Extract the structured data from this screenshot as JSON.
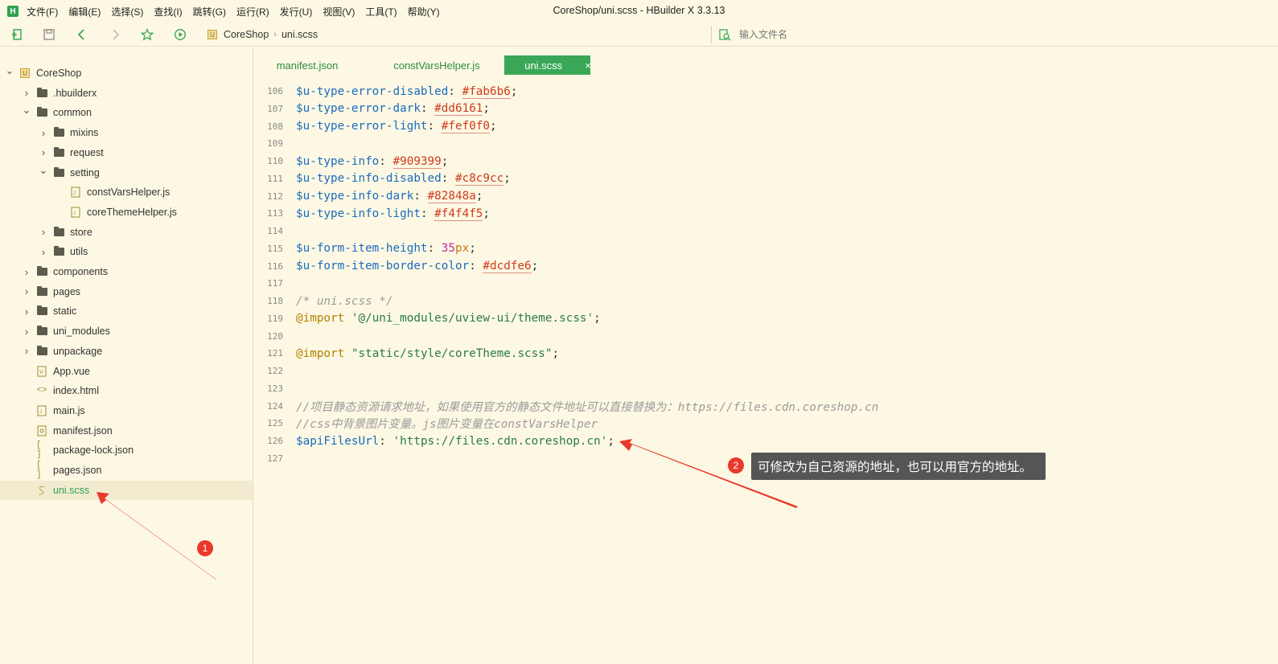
{
  "app": {
    "logo_letter": "H",
    "window_title": "CoreShop/uni.scss - HBuilder X 3.3.13",
    "accent_color": "#3aa757"
  },
  "menu": [
    "文件(F)",
    "编辑(E)",
    "选择(S)",
    "查找(I)",
    "跳转(G)",
    "运行(R)",
    "发行(U)",
    "视图(V)",
    "工具(T)",
    "帮助(Y)"
  ],
  "toolbar": {
    "icons": [
      "new-file-icon",
      "save-icon",
      "back-icon",
      "forward-icon",
      "star-icon",
      "run-icon"
    ],
    "breadcrumb": {
      "project": "CoreShop",
      "file": "uni.scss",
      "badge": "U"
    },
    "search_placeholder": "输入文件名"
  },
  "sidebar": {
    "items": [
      {
        "label": "CoreShop",
        "type": "project",
        "expanded": true,
        "level": 0
      },
      {
        "label": ".hbuilderx",
        "type": "folder",
        "expanded": false,
        "level": 1
      },
      {
        "label": "common",
        "type": "folder",
        "expanded": true,
        "level": 1
      },
      {
        "label": "mixins",
        "type": "folder",
        "expanded": false,
        "level": 2
      },
      {
        "label": "request",
        "type": "folder",
        "expanded": false,
        "level": 2
      },
      {
        "label": "setting",
        "type": "folder",
        "expanded": true,
        "level": 2
      },
      {
        "label": "constVarsHelper.js",
        "type": "js",
        "level": 3
      },
      {
        "label": "coreThemeHelper.js",
        "type": "js",
        "level": 3
      },
      {
        "label": "store",
        "type": "folder",
        "expanded": false,
        "level": 2
      },
      {
        "label": "utils",
        "type": "folder",
        "expanded": false,
        "level": 2
      },
      {
        "label": "components",
        "type": "folder",
        "expanded": false,
        "level": 1
      },
      {
        "label": "pages",
        "type": "folder",
        "expanded": false,
        "level": 1
      },
      {
        "label": "static",
        "type": "folder",
        "expanded": false,
        "level": 1
      },
      {
        "label": "uni_modules",
        "type": "folder",
        "expanded": false,
        "level": 1
      },
      {
        "label": "unpackage",
        "type": "folder",
        "expanded": false,
        "level": 1
      },
      {
        "label": "App.vue",
        "type": "vue",
        "level": 1
      },
      {
        "label": "index.html",
        "type": "html",
        "level": 1
      },
      {
        "label": "main.js",
        "type": "js",
        "level": 1
      },
      {
        "label": "manifest.json",
        "type": "manifest",
        "level": 1
      },
      {
        "label": "package-lock.json",
        "type": "json",
        "level": 1
      },
      {
        "label": "pages.json",
        "type": "json",
        "level": 1
      },
      {
        "label": "uni.scss",
        "type": "scss",
        "level": 1,
        "selected": true
      }
    ]
  },
  "tabs": [
    {
      "label": "manifest.json",
      "active": false
    },
    {
      "label": "constVarsHelper.js",
      "active": false
    },
    {
      "label": "uni.scss",
      "active": true,
      "close": "×"
    }
  ],
  "editor": {
    "lines": [
      {
        "n": "106",
        "tokens": [
          [
            "var",
            "$u-type-error-disabled"
          ],
          [
            "punct",
            ": "
          ],
          [
            "hex",
            "#fab6b6"
          ],
          [
            "punct",
            ";"
          ]
        ]
      },
      {
        "n": "107",
        "tokens": [
          [
            "var",
            "$u-type-error-dark"
          ],
          [
            "punct",
            ": "
          ],
          [
            "hex",
            "#dd6161"
          ],
          [
            "punct",
            ";"
          ]
        ]
      },
      {
        "n": "108",
        "tokens": [
          [
            "var",
            "$u-type-error-light"
          ],
          [
            "punct",
            ": "
          ],
          [
            "hex",
            "#fef0f0"
          ],
          [
            "punct",
            ";"
          ]
        ]
      },
      {
        "n": "109",
        "tokens": []
      },
      {
        "n": "110",
        "tokens": [
          [
            "var",
            "$u-type-info"
          ],
          [
            "punct",
            ": "
          ],
          [
            "hex",
            "#909399"
          ],
          [
            "punct",
            ";"
          ]
        ]
      },
      {
        "n": "111",
        "tokens": [
          [
            "var",
            "$u-type-info-disabled"
          ],
          [
            "punct",
            ": "
          ],
          [
            "hex",
            "#c8c9cc"
          ],
          [
            "punct",
            ";"
          ]
        ]
      },
      {
        "n": "112",
        "tokens": [
          [
            "var",
            "$u-type-info-dark"
          ],
          [
            "punct",
            ": "
          ],
          [
            "hex",
            "#82848a"
          ],
          [
            "punct",
            ";"
          ]
        ]
      },
      {
        "n": "113",
        "tokens": [
          [
            "var",
            "$u-type-info-light"
          ],
          [
            "punct",
            ": "
          ],
          [
            "hex",
            "#f4f4f5"
          ],
          [
            "punct",
            ";"
          ]
        ]
      },
      {
        "n": "114",
        "tokens": []
      },
      {
        "n": "115",
        "tokens": [
          [
            "var",
            "$u-form-item-height"
          ],
          [
            "punct",
            ": "
          ],
          [
            "num",
            "35"
          ],
          [
            "unit",
            "px"
          ],
          [
            "punct",
            ";"
          ]
        ]
      },
      {
        "n": "116",
        "tokens": [
          [
            "var",
            "$u-form-item-border-color"
          ],
          [
            "punct",
            ": "
          ],
          [
            "hex",
            "#dcdfe6"
          ],
          [
            "punct",
            ";"
          ]
        ]
      },
      {
        "n": "117",
        "tokens": []
      },
      {
        "n": "118",
        "tokens": [
          [
            "comment",
            "/* uni.scss */"
          ]
        ]
      },
      {
        "n": "119",
        "tokens": [
          [
            "at",
            "@import"
          ],
          [
            "punct",
            " "
          ],
          [
            "str",
            "'@/uni_modules/uview-ui/theme.scss'"
          ],
          [
            "punct",
            ";"
          ]
        ]
      },
      {
        "n": "120",
        "tokens": []
      },
      {
        "n": "121",
        "tokens": [
          [
            "at",
            "@import"
          ],
          [
            "punct",
            " "
          ],
          [
            "str",
            "\"static/style/coreTheme.scss\""
          ],
          [
            "punct",
            ";"
          ]
        ]
      },
      {
        "n": "122",
        "tokens": []
      },
      {
        "n": "123",
        "tokens": []
      },
      {
        "n": "124",
        "tokens": [
          [
            "comment",
            "//项目静态资源请求地址，如果使用官方的静态文件地址可以直接替换为：https://files.cdn.coreshop.cn"
          ]
        ]
      },
      {
        "n": "125",
        "tokens": [
          [
            "comment",
            "//css中背景图片变量。js图片变量在constVarsHelper"
          ]
        ]
      },
      {
        "n": "126",
        "tokens": [
          [
            "var",
            "$apiFilesUrl"
          ],
          [
            "punct",
            ": "
          ],
          [
            "str",
            "'https://files.cdn.coreshop.cn'"
          ],
          [
            "punct",
            ";"
          ]
        ]
      },
      {
        "n": "127",
        "tokens": []
      }
    ]
  },
  "annotations": {
    "marker_1": "1",
    "marker_2": "2",
    "callout_text": "可修改为自己资源的地址，也可以用官方的地址。",
    "arrow_color": "#e8392c"
  }
}
